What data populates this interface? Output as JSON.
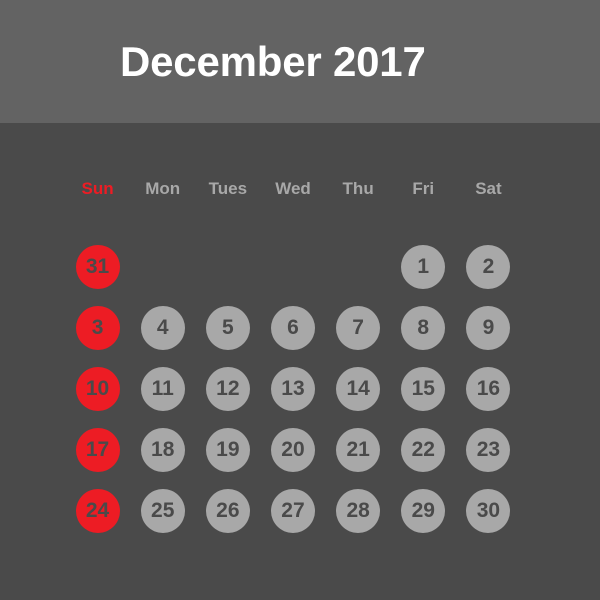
{
  "header": {
    "title": "December 2017",
    "band_color": "#636363",
    "title_color": "#ffffff"
  },
  "page": {
    "background_color": "#4a4a4a"
  },
  "colors": {
    "sunday_accent": "#ed1c24",
    "weekday_circle": "#a8a8a8",
    "numeral": "#4a4a4a",
    "weekday_label": "#a8a8a8"
  },
  "weekdays": [
    {
      "label": "Sun",
      "is_sunday": true
    },
    {
      "label": "Mon",
      "is_sunday": false
    },
    {
      "label": "Tues",
      "is_sunday": false
    },
    {
      "label": "Wed",
      "is_sunday": false
    },
    {
      "label": "Thu",
      "is_sunday": false
    },
    {
      "label": "Fri",
      "is_sunday": false
    },
    {
      "label": "Sat",
      "is_sunday": false
    }
  ],
  "weeks": [
    [
      {
        "day": "31",
        "sunday": true
      },
      {
        "day": "",
        "empty": true
      },
      {
        "day": "",
        "empty": true
      },
      {
        "day": "",
        "empty": true
      },
      {
        "day": "",
        "empty": true
      },
      {
        "day": "1",
        "sunday": false
      },
      {
        "day": "2",
        "sunday": false
      }
    ],
    [
      {
        "day": "3",
        "sunday": true
      },
      {
        "day": "4",
        "sunday": false
      },
      {
        "day": "5",
        "sunday": false
      },
      {
        "day": "6",
        "sunday": false
      },
      {
        "day": "7",
        "sunday": false
      },
      {
        "day": "8",
        "sunday": false
      },
      {
        "day": "9",
        "sunday": false
      }
    ],
    [
      {
        "day": "10",
        "sunday": true
      },
      {
        "day": "11",
        "sunday": false
      },
      {
        "day": "12",
        "sunday": false
      },
      {
        "day": "13",
        "sunday": false
      },
      {
        "day": "14",
        "sunday": false
      },
      {
        "day": "15",
        "sunday": false
      },
      {
        "day": "16",
        "sunday": false
      }
    ],
    [
      {
        "day": "17",
        "sunday": true
      },
      {
        "day": "18",
        "sunday": false
      },
      {
        "day": "19",
        "sunday": false
      },
      {
        "day": "20",
        "sunday": false
      },
      {
        "day": "21",
        "sunday": false
      },
      {
        "day": "22",
        "sunday": false
      },
      {
        "day": "23",
        "sunday": false
      }
    ],
    [
      {
        "day": "24",
        "sunday": true
      },
      {
        "day": "25",
        "sunday": false
      },
      {
        "day": "26",
        "sunday": false
      },
      {
        "day": "27",
        "sunday": false
      },
      {
        "day": "28",
        "sunday": false
      },
      {
        "day": "29",
        "sunday": false
      },
      {
        "day": "30",
        "sunday": false
      }
    ]
  ]
}
